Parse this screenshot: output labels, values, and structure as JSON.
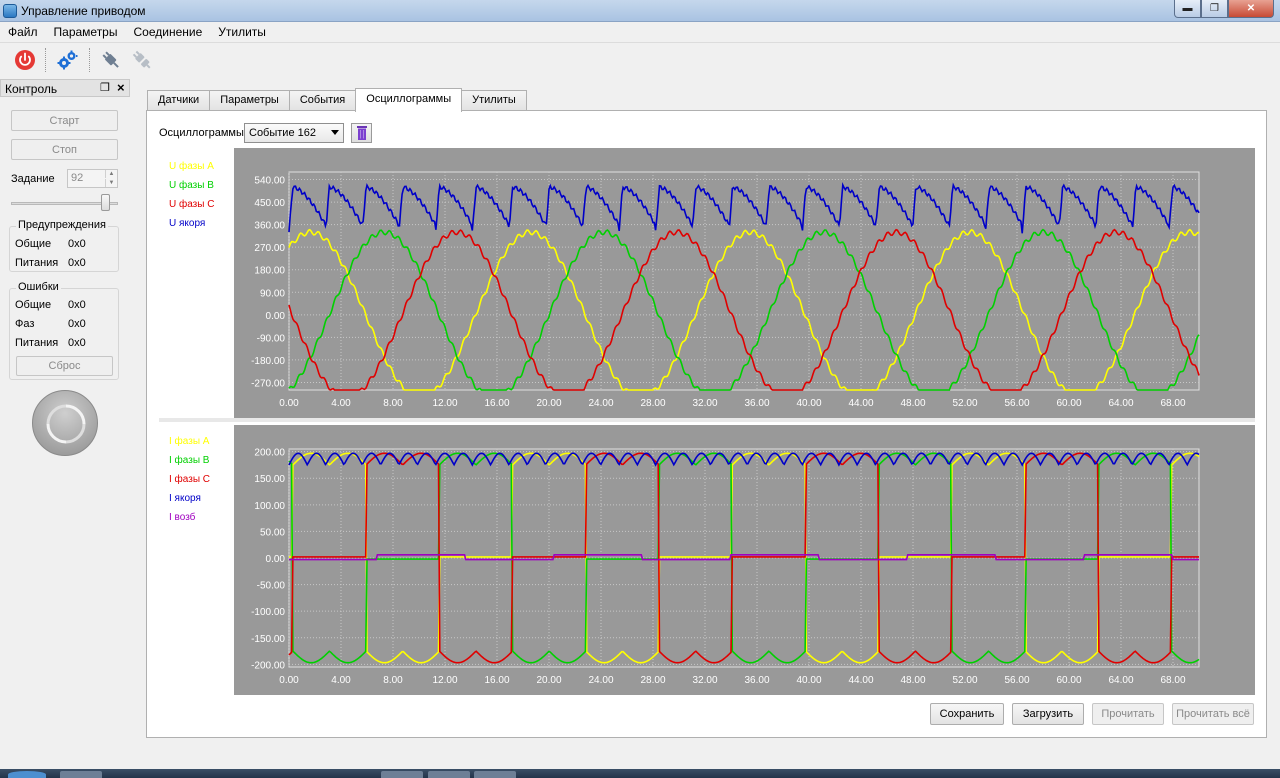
{
  "window": {
    "title": "Управление приводом"
  },
  "menu": [
    "Файл",
    "Параметры",
    "Соединение",
    "Утилиты"
  ],
  "toolbar": {
    "icons": [
      "power-icon",
      "settings-gears-icon",
      "plug-connect-icon",
      "plug-disconnect-icon"
    ],
    "colors": {
      "power": "#e53935",
      "gear": "#1e6fd6"
    }
  },
  "dock": {
    "title": "Контроль",
    "start_label": "Старт",
    "stop_label": "Стоп",
    "setpoint_label": "Задание",
    "setpoint_value": "92",
    "slider_level": 0.92,
    "warnings": {
      "title": "Предупреждения",
      "rows": [
        {
          "name": "Общие",
          "value": "0x0"
        },
        {
          "name": "Питания",
          "value": "0x0"
        }
      ]
    },
    "errors": {
      "title": "Ошибки",
      "rows": [
        {
          "name": "Общие",
          "value": "0x0"
        },
        {
          "name": "Фаз",
          "value": "0x0"
        },
        {
          "name": "Питания",
          "value": "0x0"
        }
      ],
      "reset_label": "Сброс"
    }
  },
  "tabs": [
    "Датчики",
    "Параметры",
    "События",
    "Осциллограммы",
    "Утилиты"
  ],
  "active_tab": 3,
  "oscillograms": {
    "label": "Осциллограммы",
    "selected_event": "Событие 162"
  },
  "buttons": {
    "save": "Сохранить",
    "load": "Загрузить",
    "read": "Прочитать",
    "read_all": "Прочитать всё"
  },
  "chart_data": [
    {
      "type": "line",
      "xlim": [
        0,
        70
      ],
      "ylim": [
        -300,
        570
      ],
      "xticks": [
        "0.00",
        "4.00",
        "8.00",
        "12.00",
        "16.00",
        "20.00",
        "24.00",
        "28.00",
        "32.00",
        "36.00",
        "40.00",
        "44.00",
        "48.00",
        "52.00",
        "56.00",
        "60.00",
        "64.00",
        "68.00"
      ],
      "yticks": [
        "540.00",
        "450.00",
        "360.00",
        "270.00",
        "180.00",
        "90.00",
        "0.00",
        "-90.00",
        "-180.00",
        "-270.00"
      ],
      "grid": true,
      "legend_position": "left",
      "series": [
        {
          "name": "U фазы A",
          "color": "#ffff00",
          "amplitude": 330,
          "period": 16.9,
          "phase": 0.95,
          "kind": "sine"
        },
        {
          "name": "U фазы B",
          "color": "#00d000",
          "amplitude": 330,
          "period": 16.9,
          "phase": -1.15,
          "kind": "sine"
        },
        {
          "name": "U фазы C",
          "color": "#e00000",
          "amplitude": 330,
          "period": 16.9,
          "phase": 3.05,
          "kind": "sine"
        },
        {
          "name": "U якоря",
          "color": "#0000c8",
          "high": 510,
          "low": 330,
          "period": 2.82,
          "kind": "ripple"
        }
      ]
    },
    {
      "type": "line",
      "xlim": [
        0,
        70
      ],
      "ylim": [
        -205,
        205
      ],
      "xticks": [
        "0.00",
        "4.00",
        "8.00",
        "12.00",
        "16.00",
        "20.00",
        "24.00",
        "28.00",
        "32.00",
        "36.00",
        "40.00",
        "44.00",
        "48.00",
        "52.00",
        "56.00",
        "60.00",
        "64.00",
        "68.00"
      ],
      "yticks": [
        "200.00",
        "150.00",
        "100.00",
        "50.00",
        "0.00",
        "-50.00",
        "-100.00",
        "-150.00",
        "-200.00"
      ],
      "grid": true,
      "legend_position": "left",
      "series": [
        {
          "name": "I фазы A",
          "color": "#ffff00",
          "kind": "pulse",
          "phase": 0
        },
        {
          "name": "I фазы B",
          "color": "#00d000",
          "kind": "pulse",
          "phase": 1
        },
        {
          "name": "I фазы C",
          "color": "#e00000",
          "kind": "pulse",
          "phase": 2
        },
        {
          "name": "I якоря",
          "color": "#0000c8",
          "kind": "ripple_dc"
        },
        {
          "name": "I возб",
          "color": "#a000c0",
          "kind": "small_step"
        }
      ]
    }
  ]
}
